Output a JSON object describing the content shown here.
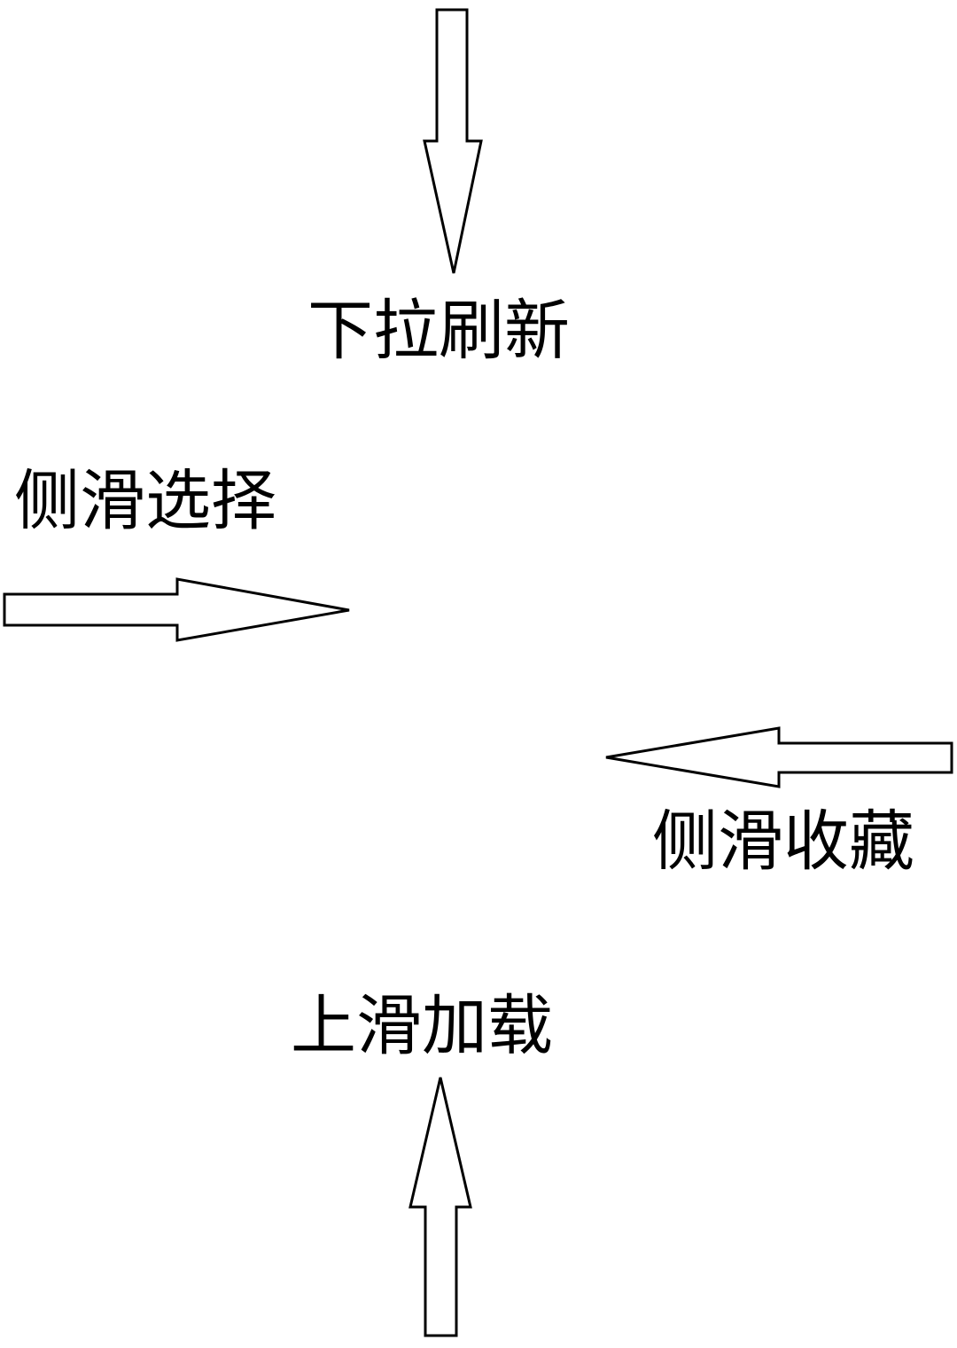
{
  "gestures": {
    "pull_refresh": {
      "label": "下拉刷新",
      "direction": "down"
    },
    "swipe_select": {
      "label": "侧滑选择",
      "direction": "right"
    },
    "swipe_favorite": {
      "label": "侧滑收藏",
      "direction": "left"
    },
    "swipe_up_load": {
      "label": "上滑加载",
      "direction": "up"
    }
  },
  "colors": {
    "stroke": "#000000",
    "fill": "#ffffff",
    "background": "#ffffff"
  }
}
